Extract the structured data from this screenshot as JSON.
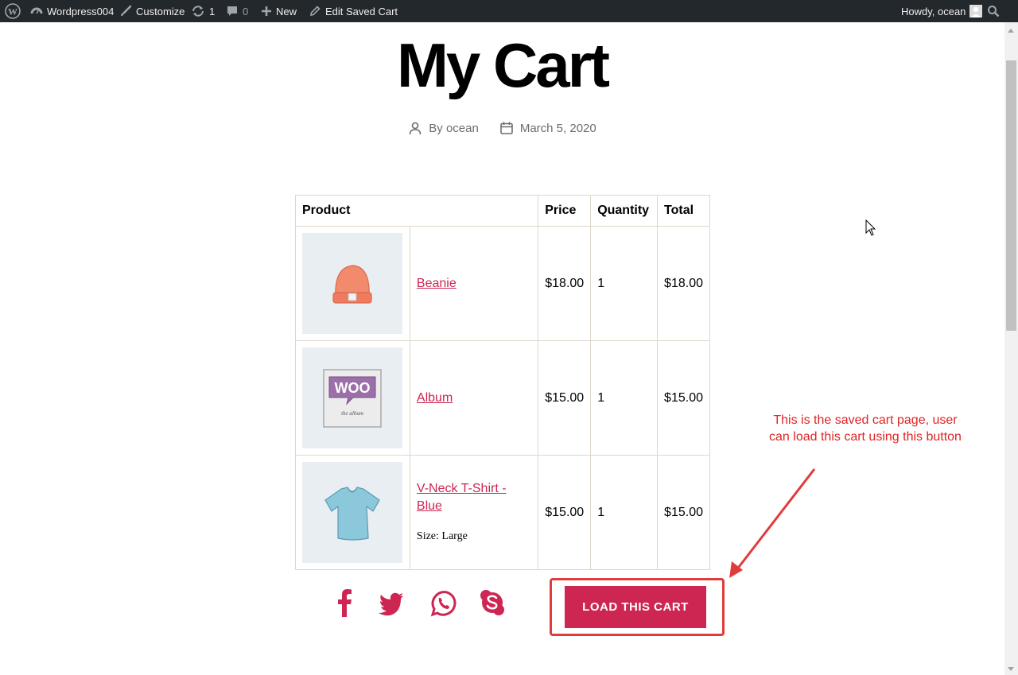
{
  "admin_bar": {
    "site_name": "Wordpress004",
    "customize": "Customize",
    "updates_count": "1",
    "comments_count": "0",
    "new_label": "New",
    "edit_label": "Edit Saved Cart",
    "howdy": "Howdy, ocean"
  },
  "post": {
    "title": "My Cart",
    "author": "By ocean",
    "date": "March 5, 2020"
  },
  "table": {
    "headers": [
      "Product",
      "Price",
      "Quantity",
      "Total"
    ],
    "rows": [
      {
        "name": "Beanie",
        "price": "$18.00",
        "quantity": "1",
        "total": "$18.00",
        "variation": ""
      },
      {
        "name": "Album",
        "price": "$15.00",
        "quantity": "1",
        "total": "$15.00",
        "variation": ""
      },
      {
        "name": "V-Neck T-Shirt - Blue",
        "price": "$15.00",
        "quantity": "1",
        "total": "$15.00",
        "variation": "Size: Large"
      }
    ]
  },
  "load_button": "LOAD THIS CART",
  "annotation": "This is the saved cart page, user can load this cart using this button",
  "colors": {
    "accent": "#cd2653",
    "annotation": "#e02424",
    "admin_bar": "#23282d"
  },
  "icons": [
    "wordpress-icon",
    "dashboard-icon",
    "brush-icon",
    "update-icon",
    "comment-icon",
    "plus-icon",
    "pencil-icon",
    "avatar-icon",
    "search-icon",
    "user-icon",
    "calendar-icon",
    "facebook-icon",
    "twitter-icon",
    "whatsapp-icon",
    "skype-icon"
  ]
}
